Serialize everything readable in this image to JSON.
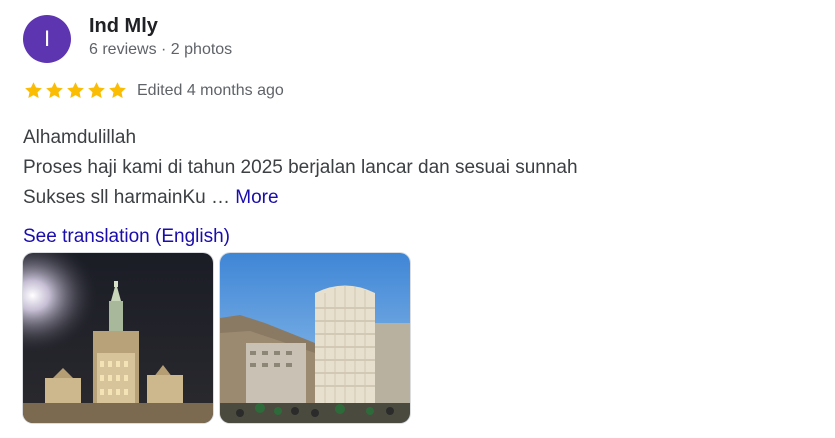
{
  "review": {
    "avatar_letter": "I",
    "author_name": "Ind Mly",
    "author_meta": "6 reviews · 2 photos",
    "rating": 5,
    "rating_max": 5,
    "edited_text": "Edited 4 months ago",
    "text_lines": [
      "Alhamdulillah",
      "Proses haji kami di tahun 2025 berjalan lancar dan sesuai sunnah",
      "Sukses sll harmainKu …"
    ],
    "more_label": "More",
    "translate_label": "See translation (English)"
  },
  "colors": {
    "avatar": "#5e35b1",
    "star": "#fbbc04",
    "link": "#1a0dab"
  },
  "icons": [
    "star-icon"
  ],
  "photos": [
    "review-photo-clock-tower-night",
    "review-photo-building-day"
  ]
}
